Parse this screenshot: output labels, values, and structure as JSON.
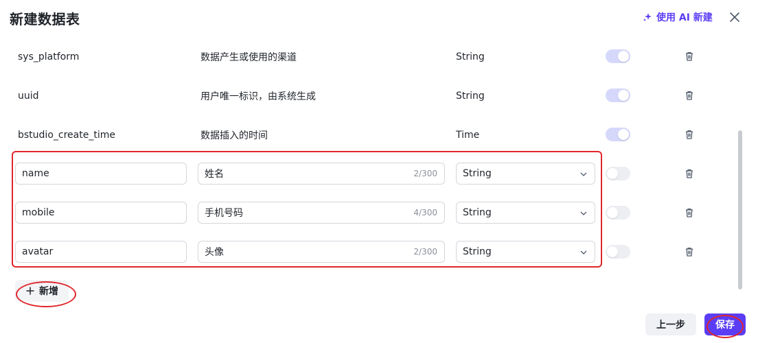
{
  "header": {
    "title": "新建数据表",
    "ai_button_label": "使用 AI 新建",
    "ai_icon": "sparkle-icon",
    "close_icon": "close-icon"
  },
  "fields": [
    {
      "name": "sys_platform",
      "description": "数据产生或使用的渠道",
      "type": "String",
      "enabled": true,
      "editable": false
    },
    {
      "name": "uuid",
      "description": "用户唯一标识，由系统生成",
      "type": "String",
      "enabled": true,
      "editable": false
    },
    {
      "name": "bstudio_create_time",
      "description": "数据插入的时间",
      "type": "Time",
      "enabled": true,
      "editable": false
    },
    {
      "name": "name",
      "description": "姓名",
      "description_count": "2/300",
      "type": "String",
      "enabled": false,
      "editable": true
    },
    {
      "name": "mobile",
      "description": "手机号码",
      "description_count": "4/300",
      "type": "String",
      "enabled": false,
      "editable": true
    },
    {
      "name": "avatar",
      "description": "头像",
      "description_count": "2/300",
      "type": "String",
      "enabled": false,
      "editable": true
    }
  ],
  "add_button": {
    "label": "新增",
    "icon": "plus-icon"
  },
  "footer": {
    "prev_label": "上一步",
    "save_label": "保存"
  },
  "colors": {
    "accent": "#5b3df5",
    "annotation_red": "#e0262c",
    "toggle_on": "#d6d8fb",
    "toggle_off": "#eceef2"
  }
}
